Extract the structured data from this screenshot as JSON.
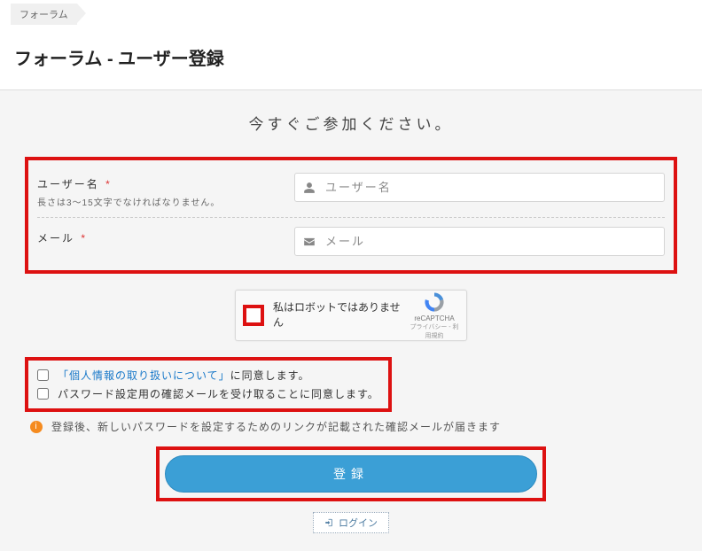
{
  "breadcrumb": {
    "item": "フォーラム"
  },
  "page_title": "フォーラム - ユーザー登録",
  "join_message": "今すぐご参加ください。",
  "fields": {
    "username": {
      "label": "ユーザー名",
      "required": "*",
      "help": "長さは3～15文字でなければなりません。",
      "placeholder": "ユーザー名"
    },
    "email": {
      "label": "メール",
      "required": "*",
      "placeholder": "メール"
    }
  },
  "captcha": {
    "label": "私はロボットではありません",
    "brand": "reCAPTCHA",
    "terms": "プライバシー - 利用規約"
  },
  "consent": {
    "privacy_link": "「個人情報の取り扱いについて」",
    "privacy_suffix": "に同意します。",
    "password_mail": "パスワード設定用の確認メールを受け取ることに同意します。"
  },
  "info_text": "登録後、新しいパスワードを設定するためのリンクが記載された確認メールが届きます",
  "submit_label": "登録",
  "login_label": "ログイン"
}
